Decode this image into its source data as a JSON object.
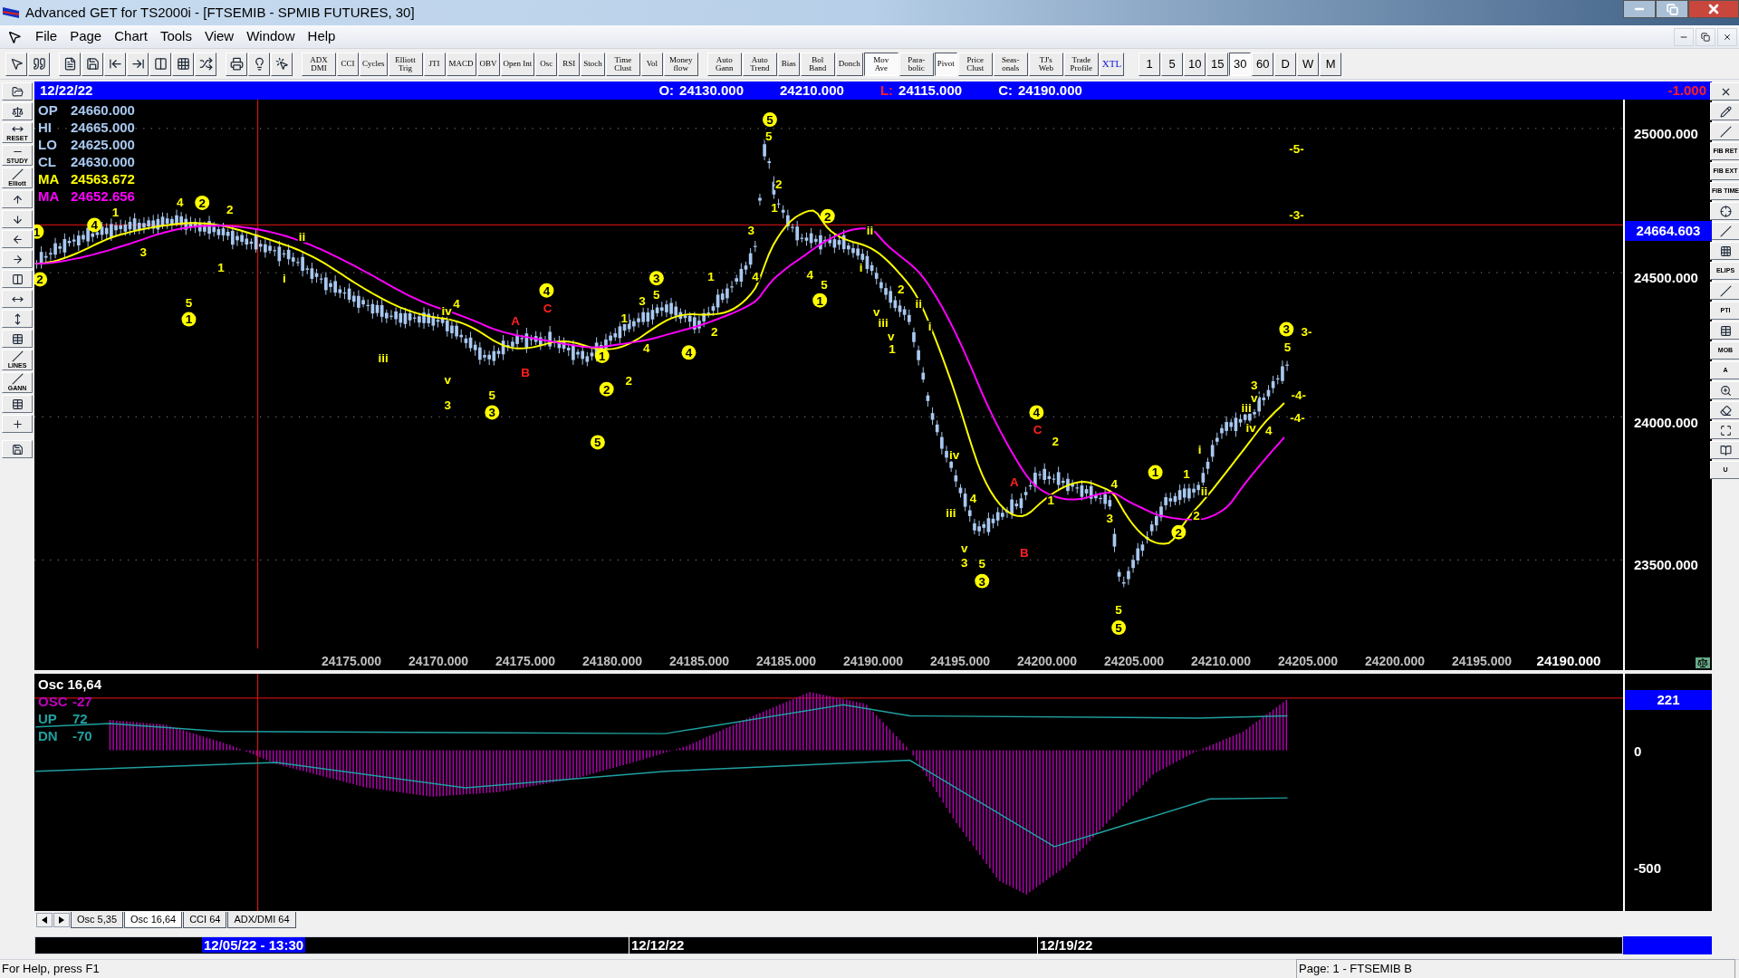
{
  "window": {
    "title": "Advanced GET for TS2000i - [FTSEMIB - SPMIB FUTURES, 30]"
  },
  "menu": [
    "File",
    "Page",
    "Chart",
    "Tools",
    "View",
    "Window",
    "Help"
  ],
  "indicator_buttons": [
    {
      "label": "ADX DMI",
      "pressed": false
    },
    {
      "label": "CCI",
      "pressed": false
    },
    {
      "label": "Cycles",
      "pressed": false
    },
    {
      "label": "Elliott Trig",
      "pressed": false
    },
    {
      "label": "JTI",
      "pressed": false
    },
    {
      "label": "MACD",
      "pressed": false
    },
    {
      "label": "OBV",
      "pressed": false
    },
    {
      "label": "Open Int",
      "pressed": false
    },
    {
      "label": "Osc",
      "pressed": false
    },
    {
      "label": "RSI",
      "pressed": false
    },
    {
      "label": "Stoch",
      "pressed": false
    },
    {
      "label": "Time Clust",
      "pressed": false
    },
    {
      "label": "Vol",
      "pressed": false
    },
    {
      "label": "Money flow",
      "pressed": false
    }
  ],
  "study_buttons": [
    {
      "label": "Auto Gann",
      "pressed": false
    },
    {
      "label": "Auto Trend",
      "pressed": false
    },
    {
      "label": "Bias",
      "pressed": false
    },
    {
      "label": "Bol Band",
      "pressed": false
    },
    {
      "label": "Donch",
      "pressed": false
    },
    {
      "label": "Mov Ave",
      "pressed": true
    },
    {
      "label": "Para-bolic",
      "pressed": false
    },
    {
      "label": "Pivot",
      "pressed": true
    },
    {
      "label": "Price Clust",
      "pressed": false
    },
    {
      "label": "Seas-onals",
      "pressed": false
    },
    {
      "label": "TJ's Web",
      "pressed": false
    },
    {
      "label": "Trade Profile",
      "pressed": false
    },
    {
      "label": "XTL",
      "pressed": false
    }
  ],
  "timeframes": [
    {
      "label": "1",
      "selected": false
    },
    {
      "label": "5",
      "selected": false
    },
    {
      "label": "10",
      "selected": false
    },
    {
      "label": "15",
      "selected": false
    },
    {
      "label": "30",
      "selected": true
    },
    {
      "label": "60",
      "selected": false
    },
    {
      "label": "D",
      "selected": false
    },
    {
      "label": "W",
      "selected": false
    },
    {
      "label": "M",
      "selected": false
    }
  ],
  "left_tools": [
    "RESET",
    "STUDY",
    "Elliott",
    "LINES",
    "GANN"
  ],
  "right_tools": [
    "FIB RET",
    "FIB EXT",
    "FIB TIME",
    "ELIPS",
    "PTI",
    "MOB",
    "A",
    "U"
  ],
  "info_bar": {
    "date": "12/22/22",
    "quotes": [
      {
        "label": "O:",
        "value": "24130.000",
        "color": "#ffffff"
      },
      {
        "value": "24210.000"
      },
      {
        "label": "L:",
        "value": "24115.000",
        "color": "#ff2020"
      },
      {
        "label": "C:",
        "value": "24190.000",
        "color": "#ffffff"
      }
    ],
    "change": "-1.000"
  },
  "legend": [
    {
      "label": "OP",
      "value": "24660.000",
      "color": "#a8c8f0"
    },
    {
      "label": "HI",
      "value": "24665.000",
      "color": "#a8c8f0"
    },
    {
      "label": "LO",
      "value": "24625.000",
      "color": "#a8c8f0"
    },
    {
      "label": "CL",
      "value": "24630.000",
      "color": "#a8c8f0"
    },
    {
      "label": "MA",
      "value": "24563.672",
      "color": "#ffff00"
    },
    {
      "label": "MA",
      "value": "24652.656",
      "color": "#ff00ff"
    }
  ],
  "wave_labels": [
    {
      "text": "2",
      "kind": "circled",
      "color": "#ffff00"
    },
    {
      "text": "1",
      "kind": "circled",
      "color": "#ffff00"
    },
    {
      "text": "4",
      "kind": "circled",
      "color": "#ffff00"
    },
    {
      "text": "1",
      "kind": "plain",
      "color": "#ffff00"
    },
    {
      "text": "3",
      "kind": "plain",
      "color": "#ffff00"
    },
    {
      "text": "4",
      "kind": "plain",
      "color": "#ffff00"
    },
    {
      "text": "2",
      "kind": "circled",
      "color": "#ffff00"
    },
    {
      "text": "2",
      "kind": "plain",
      "color": "#ffff00"
    },
    {
      "text": "5",
      "kind": "plain",
      "color": "#ffff00"
    },
    {
      "text": "1",
      "kind": "circled",
      "color": "#ffff00"
    },
    {
      "text": "1",
      "kind": "plain",
      "color": "#ffff00"
    },
    {
      "text": "i",
      "kind": "plain",
      "color": "#ffff00"
    },
    {
      "text": "ii",
      "kind": "plain",
      "color": "#ffff00"
    },
    {
      "text": "iii",
      "kind": "plain",
      "color": "#ffff00"
    },
    {
      "text": "iv",
      "kind": "plain",
      "color": "#ffff00"
    },
    {
      "text": "4",
      "kind": "plain",
      "color": "#ffff00"
    },
    {
      "text": "v",
      "kind": "plain",
      "color": "#ffff00"
    },
    {
      "text": "3",
      "kind": "plain",
      "color": "#ffff00"
    },
    {
      "text": "5",
      "kind": "plain",
      "color": "#ffff00"
    },
    {
      "text": "3",
      "kind": "circled",
      "color": "#ffff00"
    },
    {
      "text": "A",
      "kind": "plain",
      "color": "#ff2020"
    },
    {
      "text": "B",
      "kind": "plain",
      "color": "#ff2020"
    },
    {
      "text": "4",
      "kind": "circled",
      "color": "#ffff00"
    },
    {
      "text": "C",
      "kind": "plain",
      "color": "#ff2020"
    },
    {
      "text": "1",
      "kind": "circled",
      "color": "#ffff00"
    },
    {
      "text": "2",
      "kind": "circled",
      "color": "#ffff00"
    },
    {
      "text": "5",
      "kind": "circled",
      "color": "#ffff00"
    },
    {
      "text": "2",
      "kind": "plain",
      "color": "#ffff00"
    },
    {
      "text": "1",
      "kind": "plain",
      "color": "#ffff00"
    },
    {
      "text": "3",
      "kind": "plain",
      "color": "#ffff00"
    },
    {
      "text": "4",
      "kind": "plain",
      "color": "#ffff00"
    },
    {
      "text": "3",
      "kind": "circled",
      "color": "#ffff00"
    },
    {
      "text": "5",
      "kind": "plain",
      "color": "#ffff00"
    },
    {
      "text": "4",
      "kind": "circled",
      "color": "#ffff00"
    },
    {
      "text": "1",
      "kind": "plain",
      "color": "#ffff00"
    },
    {
      "text": "2",
      "kind": "plain",
      "color": "#ffff00"
    },
    {
      "text": "3",
      "kind": "plain",
      "color": "#ffff00"
    },
    {
      "text": "4",
      "kind": "plain",
      "color": "#ffff00"
    },
    {
      "text": "5",
      "kind": "circled",
      "color": "#ffff00"
    },
    {
      "text": "5",
      "kind": "plain",
      "color": "#ffff00"
    },
    {
      "text": "2",
      "kind": "plain",
      "color": "#ffff00"
    },
    {
      "text": "1",
      "kind": "plain",
      "color": "#ffff00"
    },
    {
      "text": "2",
      "kind": "circled",
      "color": "#ffff00"
    },
    {
      "text": "4",
      "kind": "plain",
      "color": "#ffff00"
    },
    {
      "text": "5",
      "kind": "plain",
      "color": "#ffff00"
    },
    {
      "text": "1",
      "kind": "circled",
      "color": "#ffff00"
    },
    {
      "text": "ii",
      "kind": "plain",
      "color": "#ffff00"
    },
    {
      "text": "i",
      "kind": "plain",
      "color": "#ffff00"
    },
    {
      "text": "v",
      "kind": "plain",
      "color": "#ffff00"
    },
    {
      "text": "2",
      "kind": "plain",
      "color": "#ffff00"
    },
    {
      "text": "iii",
      "kind": "plain",
      "color": "#ffff00"
    },
    {
      "text": "ii",
      "kind": "plain",
      "color": "#ffff00"
    },
    {
      "text": "v",
      "kind": "plain",
      "color": "#ffff00"
    },
    {
      "text": "1",
      "kind": "plain",
      "color": "#ffff00"
    },
    {
      "text": "i",
      "kind": "plain",
      "color": "#ffff00"
    },
    {
      "text": "iv",
      "kind": "plain",
      "color": "#ffff00"
    },
    {
      "text": "iii",
      "kind": "plain",
      "color": "#ffff00"
    },
    {
      "text": "4",
      "kind": "plain",
      "color": "#ffff00"
    },
    {
      "text": "v",
      "kind": "plain",
      "color": "#ffff00"
    },
    {
      "text": "3",
      "kind": "plain",
      "color": "#ffff00"
    },
    {
      "text": "5",
      "kind": "plain",
      "color": "#ffff00"
    },
    {
      "text": "3",
      "kind": "circled",
      "color": "#ffff00"
    },
    {
      "text": "A",
      "kind": "plain",
      "color": "#ff2020"
    },
    {
      "text": "4",
      "kind": "circled",
      "color": "#ffff00"
    },
    {
      "text": "C",
      "kind": "plain",
      "color": "#ff2020"
    },
    {
      "text": "B",
      "kind": "plain",
      "color": "#ff2020"
    },
    {
      "text": "2",
      "kind": "plain",
      "color": "#ffff00"
    },
    {
      "text": "1",
      "kind": "plain",
      "color": "#ffff00"
    },
    {
      "text": "4",
      "kind": "plain",
      "color": "#ffff00"
    },
    {
      "text": "3",
      "kind": "plain",
      "color": "#ffff00"
    },
    {
      "text": "5",
      "kind": "plain",
      "color": "#ffff00"
    },
    {
      "text": "5",
      "kind": "circled",
      "color": "#ffff00"
    },
    {
      "text": "1",
      "kind": "circled",
      "color": "#ffff00"
    },
    {
      "text": "2",
      "kind": "circled",
      "color": "#ffff00"
    },
    {
      "text": "i",
      "kind": "plain",
      "color": "#ffff00"
    },
    {
      "text": "1",
      "kind": "plain",
      "color": "#ffff00"
    },
    {
      "text": "ii",
      "kind": "plain",
      "color": "#ffff00"
    },
    {
      "text": "2",
      "kind": "plain",
      "color": "#ffff00"
    },
    {
      "text": "iii",
      "kind": "plain",
      "color": "#ffff00"
    },
    {
      "text": "3",
      "kind": "plain",
      "color": "#ffff00"
    },
    {
      "text": "v",
      "kind": "plain",
      "color": "#ffff00"
    },
    {
      "text": "iv",
      "kind": "plain",
      "color": "#ffff00"
    },
    {
      "text": "4",
      "kind": "plain",
      "color": "#ffff00"
    },
    {
      "text": "3",
      "kind": "circled",
      "color": "#ffff00"
    },
    {
      "text": "5",
      "kind": "plain",
      "color": "#ffff00"
    },
    {
      "text": "-5-",
      "kind": "plain",
      "color": "#ffff00"
    },
    {
      "text": "-3-",
      "kind": "plain",
      "color": "#ffff00"
    },
    {
      "text": "3-",
      "kind": "plain",
      "color": "#ffff00"
    },
    {
      "text": "-4-",
      "kind": "plain",
      "color": "#ffff00"
    },
    {
      "text": "-4-",
      "kind": "plain",
      "color": "#ffff00"
    }
  ],
  "x_axis_labels": [
    "24175.000",
    "24170.000",
    "24175.000",
    "24180.000",
    "24185.000",
    "24185.000",
    "24190.000",
    "24195.000",
    "24200.000",
    "24205.000",
    "24210.000",
    "24205.000",
    "24200.000",
    "24195.000",
    "24190.000"
  ],
  "price_axis": {
    "ticks": [
      "25000.000",
      "24500.000",
      "24000.000",
      "23500.000"
    ],
    "marker": "24664.603"
  },
  "oscillator": {
    "title": "Osc 16,64",
    "legend": [
      {
        "label": "OSC",
        "value": "-27",
        "color": "#c000c0"
      },
      {
        "label": "UP",
        "value": "72",
        "color": "#20a0a0"
      },
      {
        "label": "DN",
        "value": "-70",
        "color": "#20a0a0"
      }
    ],
    "marker": "221",
    "ticks": [
      "0",
      "-500"
    ]
  },
  "tabs": [
    {
      "label": "Osc 5,35",
      "selected": false
    },
    {
      "label": "Osc 16,64",
      "selected": true
    },
    {
      "label": "CCI 64",
      "selected": false
    },
    {
      "label": "ADX/DMI 64",
      "selected": false
    }
  ],
  "date_bar": [
    {
      "label": "12/05/22 - 13:30",
      "selected": true
    },
    {
      "label": "12/12/22",
      "selected": false
    },
    {
      "label": "12/19/22",
      "selected": false
    }
  ],
  "status_bar": {
    "help": "For Help, press F1",
    "page": "Page: 1 - FTSEMIB B"
  }
}
